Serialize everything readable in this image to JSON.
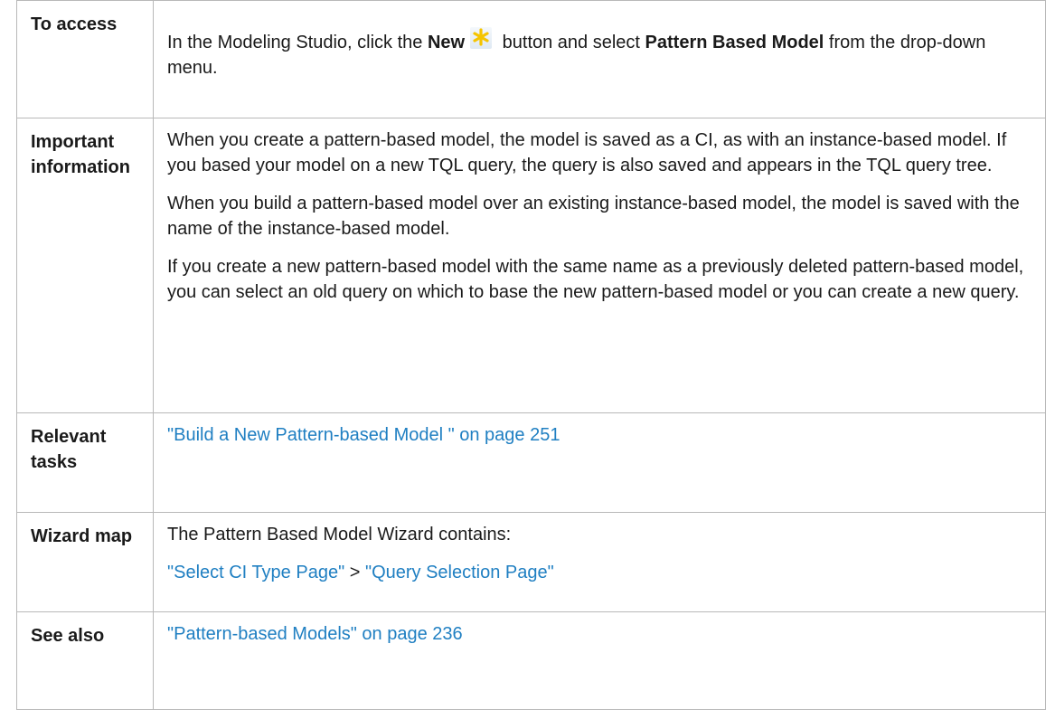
{
  "rows": [
    {
      "label": "To access",
      "text_before": "In the Modeling Studio, click the ",
      "bold_new": "New",
      "icon": "new-asterisk-icon",
      "text_middle": " button and select ",
      "bold_pbm": "Pattern Based Model",
      "text_after": " from the drop-down menu."
    },
    {
      "label": "Important information",
      "paragraphs": [
        "When you create a pattern-based model, the model is saved as a CI, as with an instance-based model. If you based your model on a new TQL query, the query is also saved and appears in the TQL query tree.",
        "When you build a pattern-based model over an existing instance-based model, the model is saved with the name of the instance-based model.",
        "If you create a new pattern-based model with the same name as a previously deleted pattern-based model, you can select an old query on which to base the new pattern-based model or you can create a new query."
      ]
    },
    {
      "label": "Relevant tasks",
      "link": "\"Build a New Pattern-based Model \" on page 251"
    },
    {
      "label": "Wizard map",
      "intro": "The Pattern Based Model Wizard contains:",
      "link1": "\"Select CI Type Page\"",
      "separator": " > ",
      "link2": "\"Query Selection Page\""
    },
    {
      "label": "See also",
      "link": "\"Pattern-based Models\" on page 236"
    }
  ],
  "colors": {
    "link": "#1f7fc2",
    "border": "#b8b8b8",
    "icon_star": "#f5c400"
  }
}
